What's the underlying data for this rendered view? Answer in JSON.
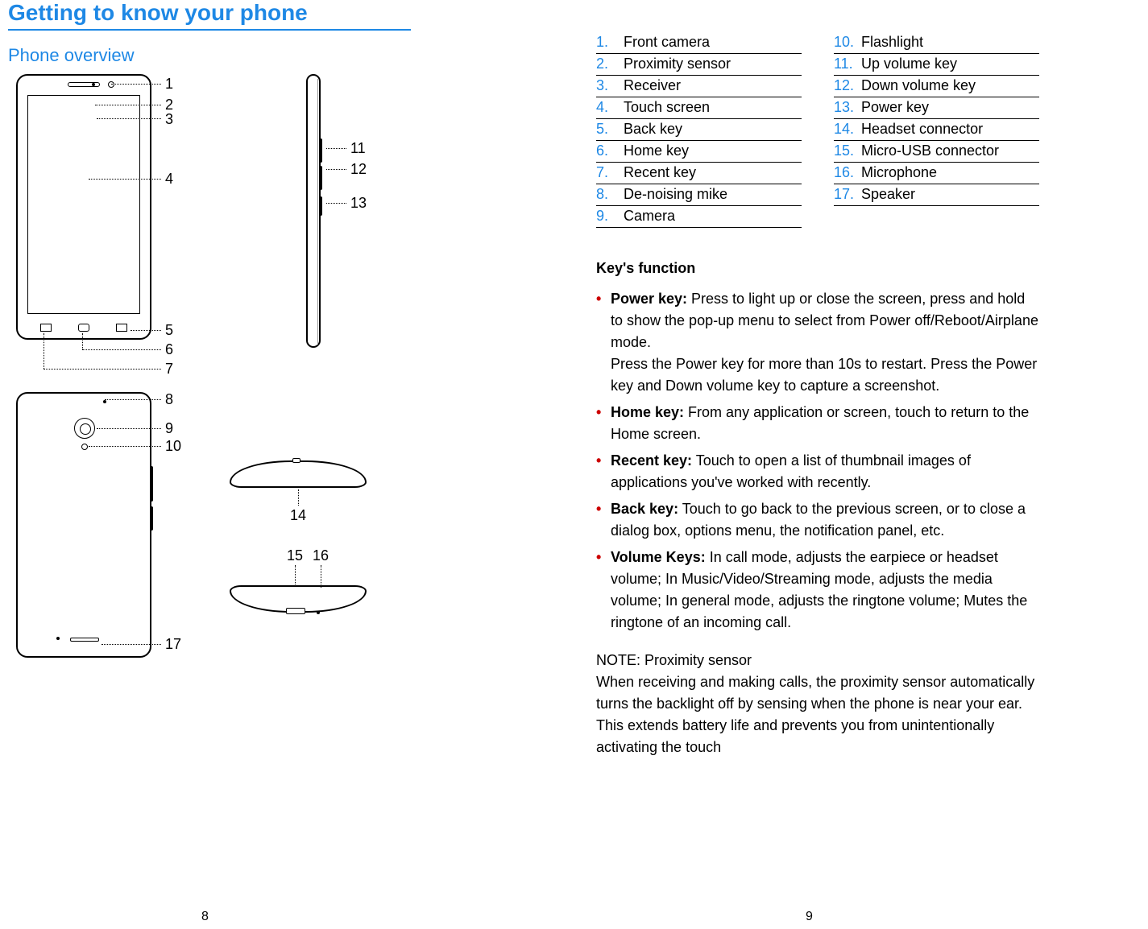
{
  "titles": {
    "main": "Getting to know your phone",
    "sub": "Phone overview"
  },
  "callouts": {
    "c1": "1",
    "c2": "2",
    "c3": "3",
    "c4": "4",
    "c5": "5",
    "c6": "6",
    "c7": "7",
    "c8": "8",
    "c9": "9",
    "c10": "10",
    "c11": "11",
    "c12": "12",
    "c13": "13",
    "c14": "14",
    "c15": "15",
    "c16": "16",
    "c17": "17"
  },
  "parts_left": [
    {
      "num": "1.",
      "label": "Front camera"
    },
    {
      "num": "2.",
      "label": "Proximity sensor"
    },
    {
      "num": "3.",
      "label": "Receiver"
    },
    {
      "num": "4.",
      "label": "Touch screen"
    },
    {
      "num": "5.",
      "label": "Back key"
    },
    {
      "num": "6.",
      "label": "Home key"
    },
    {
      "num": "7.",
      "label": "Recent key"
    },
    {
      "num": "8.",
      "label": "De-noising mike"
    },
    {
      "num": "9.",
      "label": "Camera"
    }
  ],
  "parts_right": [
    {
      "num": "10.",
      "label": "Flashlight"
    },
    {
      "num": "11.",
      "label": "Up volume key"
    },
    {
      "num": "12.",
      "label": "Down volume key"
    },
    {
      "num": "13.",
      "label": "Power key"
    },
    {
      "num": "14.",
      "label": "Headset connector"
    },
    {
      "num": "15.",
      "label": "Micro-USB connector"
    },
    {
      "num": "16.",
      "label": "Microphone"
    },
    {
      "num": "17.",
      "label": "Speaker"
    }
  ],
  "key_func": {
    "title": "Key's function",
    "items": [
      {
        "bold": "Power key:",
        "text": " Press to light up or close the screen, press and hold to show the pop-up menu to select from Power off/Reboot/Airplane mode.\nPress the Power key for more than 10s to restart. Press the Power key and Down volume key to capture a screenshot."
      },
      {
        "bold": "Home key:",
        "text": " From any application or screen, touch to return to the Home screen."
      },
      {
        "bold": "Recent key:",
        "text": " Touch to open a list of thumbnail images of applications you've worked with recently."
      },
      {
        "bold": "Back key:",
        "text": " Touch to go back to the previous screen, or to close a dialog box, options menu, the notification panel, etc."
      },
      {
        "bold": "Volume Keys:",
        "text": " In call mode, adjusts the earpiece or headset volume; In Music/Video/Streaming mode, adjusts the media volume; In general mode, adjusts the ringtone volume; Mutes the ringtone of an incoming call."
      }
    ]
  },
  "note": {
    "title": "NOTE: Proximity sensor",
    "body": "When receiving and making calls, the proximity sensor automatically turns the backlight off by sensing when the phone is near your ear. This extends battery life and prevents you from unintentionally activating the touch"
  },
  "page_numbers": {
    "left": "8",
    "right": "9"
  }
}
